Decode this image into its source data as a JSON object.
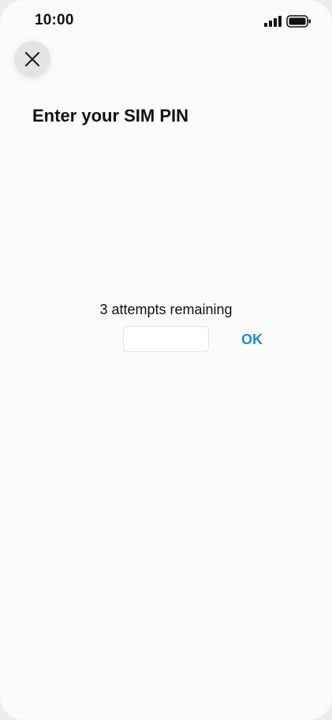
{
  "status_bar": {
    "time": "10:00",
    "signal_icon": "cellular-signal-icon",
    "battery_icon": "battery-full-icon"
  },
  "header": {
    "close_icon": "close-icon"
  },
  "page": {
    "title": "Enter your SIM PIN",
    "attempts_text": "3 attempts remaining"
  },
  "pin_form": {
    "input_value": "",
    "placeholder": "",
    "ok_label": "OK"
  },
  "colors": {
    "accent": "#1e8cd6",
    "background": "#fbfbfb",
    "close_button_bg": "#e4e4e4",
    "text": "#111111"
  }
}
